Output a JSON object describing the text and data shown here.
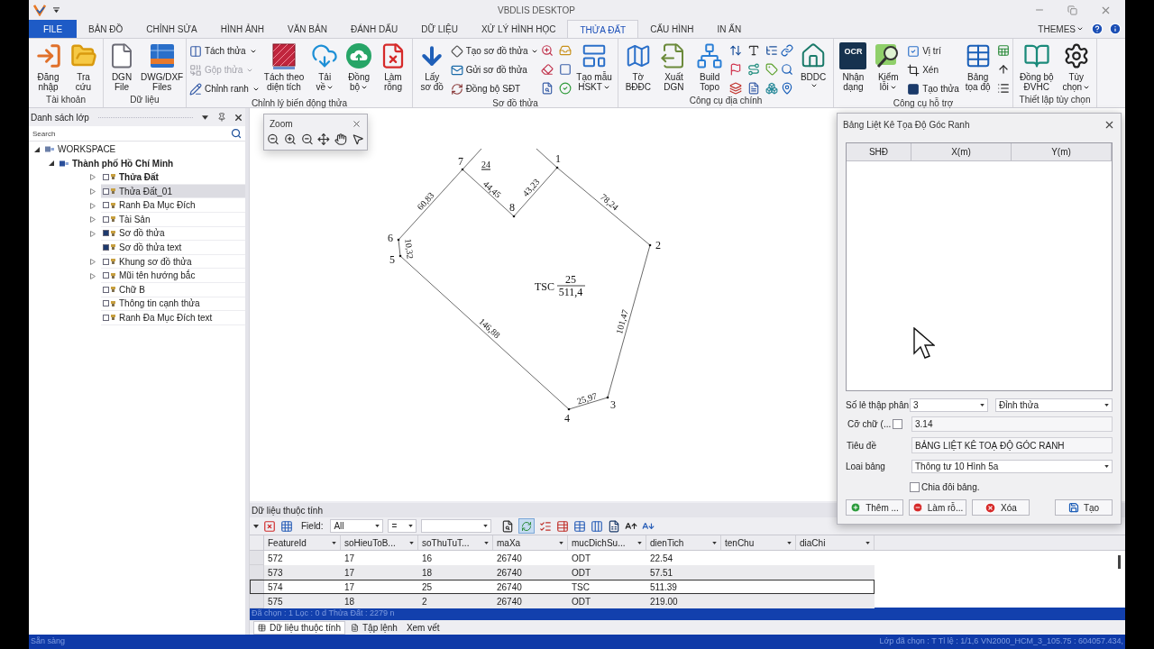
{
  "window": {
    "title": "VBDLIS DESKTOP"
  },
  "ribbon_tabs": [
    {
      "label": "FILE",
      "kind": "backstage",
      "selected": false
    },
    {
      "label": "BẢN ĐỒ",
      "kind": "tab",
      "selected": false
    },
    {
      "label": "CHỈNH SỬA",
      "kind": "tab",
      "selected": false
    },
    {
      "label": "HÌNH ẢNH",
      "kind": "tab",
      "selected": false
    },
    {
      "label": "VĂN BẢN",
      "kind": "tab",
      "selected": false
    },
    {
      "label": "ĐÁNH DẤU",
      "kind": "tab",
      "selected": false
    },
    {
      "label": "DỮ LIỆU",
      "kind": "tab",
      "selected": false
    },
    {
      "label": "XỬ LÝ HÌNH HỌC",
      "kind": "tab",
      "selected": false
    },
    {
      "label": "THỬA ĐẤT",
      "kind": "tab",
      "selected": true
    },
    {
      "label": "CẤU HÌNH",
      "kind": "tab",
      "selected": false
    },
    {
      "label": "IN ẤN",
      "kind": "tab",
      "selected": false
    }
  ],
  "themes": {
    "label": "THEMES"
  },
  "ribbon_groups": [
    {
      "label": "Tài khoản",
      "items": [
        {
          "kind": "large",
          "label": "Đăng\nnhập",
          "has_menu": false
        },
        {
          "kind": "large",
          "label": "Tra\ncứu",
          "has_menu": false
        }
      ]
    },
    {
      "label": "Dữ liệu",
      "items": [
        {
          "kind": "large",
          "label": "DGN\nFile",
          "has_menu": false
        },
        {
          "kind": "large",
          "label": "DWG/DXF\nFiles",
          "has_menu": false
        }
      ]
    },
    {
      "label": "Chỉnh lý biến động thửa",
      "items": [
        {
          "kind": "stack",
          "buttons": [
            {
              "label": "Tách thửa",
              "has_menu": true,
              "disabled": false
            },
            {
              "label": "Gộp thửa",
              "has_menu": true,
              "disabled": true
            },
            {
              "label": "Chỉnh ranh",
              "has_menu": true,
              "disabled": false
            }
          ]
        },
        {
          "kind": "large",
          "label": "Tách theo\ndiện tích",
          "has_menu": false
        },
        {
          "kind": "large",
          "label": "Tải\nvề",
          "has_menu": true
        },
        {
          "kind": "large",
          "label": "Đồng\nbộ",
          "has_menu": true
        },
        {
          "kind": "large",
          "label": "Làm\nrỗng",
          "has_menu": false
        }
      ]
    },
    {
      "label": "Sơ đồ thửa",
      "items": [
        {
          "kind": "large",
          "label": "Lấy\nsơ đồ",
          "has_menu": false
        },
        {
          "kind": "stack",
          "buttons": [
            {
              "label": "Tạo sơ đồ thửa",
              "has_menu": true,
              "disabled": false
            },
            {
              "label": "Gửi sơ đồ thửa",
              "has_menu": false,
              "disabled": false
            },
            {
              "label": "Đồng bộ SĐT",
              "has_menu": false,
              "disabled": false
            }
          ]
        },
        {
          "kind": "icons"
        },
        {
          "kind": "large",
          "label": "Tạo mẫu\nHSKT",
          "has_menu": true
        }
      ]
    },
    {
      "label": "Công cụ địa chính",
      "items": [
        {
          "kind": "large",
          "label": "Tờ\nBĐĐC",
          "has_menu": false
        },
        {
          "kind": "large",
          "label": "Xuất\nDGN",
          "has_menu": false
        },
        {
          "kind": "large",
          "label": "Build\nTopo",
          "has_menu": false
        },
        {
          "kind": "icons"
        },
        {
          "kind": "icons"
        },
        {
          "kind": "large",
          "label": "BDDC",
          "has_menu": true
        }
      ]
    },
    {
      "label": "Công cụ hỗ trợ",
      "items": [
        {
          "kind": "large",
          "label": "Nhận\ndạng",
          "has_menu": false,
          "badge": "OCR"
        },
        {
          "kind": "large",
          "label": "Kiểm\nlỗi",
          "has_menu": true
        },
        {
          "kind": "stack",
          "buttons": [
            {
              "label": "Vị trí",
              "has_menu": false,
              "disabled": false
            },
            {
              "label": "Xén",
              "has_menu": false,
              "disabled": false
            },
            {
              "label": "Tạo thửa",
              "has_menu": false,
              "disabled": false
            }
          ]
        },
        {
          "kind": "large",
          "label": "Bảng\ntọa độ",
          "has_menu": false
        },
        {
          "kind": "icons"
        }
      ]
    },
    {
      "label": "Thiết lập tùy chọn",
      "items": [
        {
          "kind": "large",
          "label": "Đồng bộ\nĐVHC",
          "has_menu": false
        },
        {
          "kind": "large",
          "label": "Tùy\nchọn",
          "has_menu": true
        }
      ]
    }
  ],
  "layer_panel": {
    "title": "Danh sách lớp",
    "search": {
      "placeholder": "Search"
    },
    "tree": [
      {
        "label": "WORKSPACE",
        "expanded": true,
        "emphasized": false,
        "children": [
          {
            "label": "Thành phố Hồ Chí Minh",
            "expanded": true,
            "emphasized": true,
            "children": [
              {
                "label": "Thửa Đất",
                "expandable": true,
                "checked": false,
                "selected": false,
                "emphasized": true
              },
              {
                "label": "Thửa Đất_01",
                "expandable": true,
                "checked": false,
                "selected": true,
                "emphasized": false
              },
              {
                "label": "Ranh Đa Mục Đích",
                "expandable": true,
                "checked": false,
                "selected": false,
                "emphasized": false
              },
              {
                "label": "Tài Sản",
                "expandable": true,
                "checked": false,
                "selected": false,
                "emphasized": false
              },
              {
                "label": "Sơ đồ thửa",
                "expandable": true,
                "checked": true,
                "selected": false,
                "emphasized": false
              },
              {
                "label": "Sơ đồ thửa text",
                "expandable": false,
                "checked": true,
                "selected": false,
                "emphasized": false
              },
              {
                "label": "Khung sơ đồ thửa",
                "expandable": true,
                "checked": false,
                "selected": false,
                "emphasized": false
              },
              {
                "label": "Mũi tên hướng bắc",
                "expandable": true,
                "checked": false,
                "selected": false,
                "emphasized": false
              },
              {
                "label": "Chữ B",
                "expandable": false,
                "checked": false,
                "selected": false,
                "emphasized": false
              },
              {
                "label": "Thông tin cạnh thửa",
                "expandable": false,
                "checked": false,
                "selected": false,
                "emphasized": false
              },
              {
                "label": "Ranh Đa Mục Đích text",
                "expandable": false,
                "checked": false,
                "selected": false,
                "emphasized": false
              }
            ]
          }
        ]
      }
    ]
  },
  "zoom_toolbar": {
    "title": "Zoom"
  },
  "map_canvas": {
    "parcel": {
      "vertices": [
        "1",
        "2",
        "3",
        "4",
        "5",
        "6",
        "7",
        "8"
      ],
      "edges": [
        "78,24",
        "101,47",
        "25,97",
        "146,88",
        "10,32",
        "60,83",
        "44,45",
        "43,23"
      ],
      "land_use": "TSC",
      "parcel_number": "25",
      "area": "511,4",
      "neighbor_number": "24"
    }
  },
  "attribute_panel": {
    "title": "Dữ liệu thuộc tính",
    "field_label": "Field:",
    "field_value": "All",
    "operator_value": "=",
    "sync_toggle": {
      "on": true
    },
    "columns": [
      "FeatureId",
      "soHieuToB...",
      "soThuTuT...",
      "maXa",
      "mucDichSu...",
      "dienTich",
      "tenChu",
      "diaChi"
    ],
    "rows": [
      {
        "cells": [
          "572",
          "17",
          "16",
          "26740",
          "ODT",
          "22.54"
        ],
        "selected": false
      },
      {
        "cells": [
          "573",
          "17",
          "18",
          "26740",
          "ODT",
          "57.51"
        ],
        "selected": false
      },
      {
        "cells": [
          "574",
          "17",
          "25",
          "26740",
          "TSC",
          "511.39"
        ],
        "selected": true
      },
      {
        "cells": [
          "575",
          "18",
          "2",
          "26740",
          "ODT",
          "219.00"
        ],
        "selected": false
      }
    ],
    "status": "Đã chọn : 1 Lọc : 0 d Thửa Đất : 2279 n",
    "tabs": [
      {
        "label": "Dữ liệu thuộc tính",
        "selected": true
      },
      {
        "label": "Tập lệnh",
        "selected": false
      },
      {
        "label": "Xem vết",
        "selected": false
      }
    ]
  },
  "coordinate_dialog": {
    "title": "Bảng Liệt Kê Tọa Độ Góc Ranh",
    "columns": [
      "SHĐ",
      "X(m)",
      "Y(m)"
    ],
    "decimal": {
      "label": "Số lẻ thập phân",
      "value": "3"
    },
    "point_type": {
      "value": "Đỉnh thửa"
    },
    "font_size": {
      "label": "Cỡ chữ (...",
      "checked": false,
      "value": "3.14"
    },
    "title_field": {
      "label": "Tiêu đề",
      "value": "BẢNG LIỆT KÊ TOẠ ĐỘ GÓC RANH"
    },
    "table_type": {
      "label": "Loai bảng",
      "value": "Thông tư 10 Hình 5a"
    },
    "split_table": {
      "label": "Chia đôi bảng.",
      "checked": false
    },
    "buttons": [
      {
        "label": "Thêm ..."
      },
      {
        "label": "Làm rỗ..."
      },
      {
        "label": "Xóa"
      },
      {
        "label": "Tạo"
      }
    ]
  },
  "status_bar": {
    "left": "Sẵn sàng",
    "right": "Lớp đã chọn : T Tỉ lệ : 1/1,6 VN2000_HCM_3_105.75 : 604057.434,"
  }
}
